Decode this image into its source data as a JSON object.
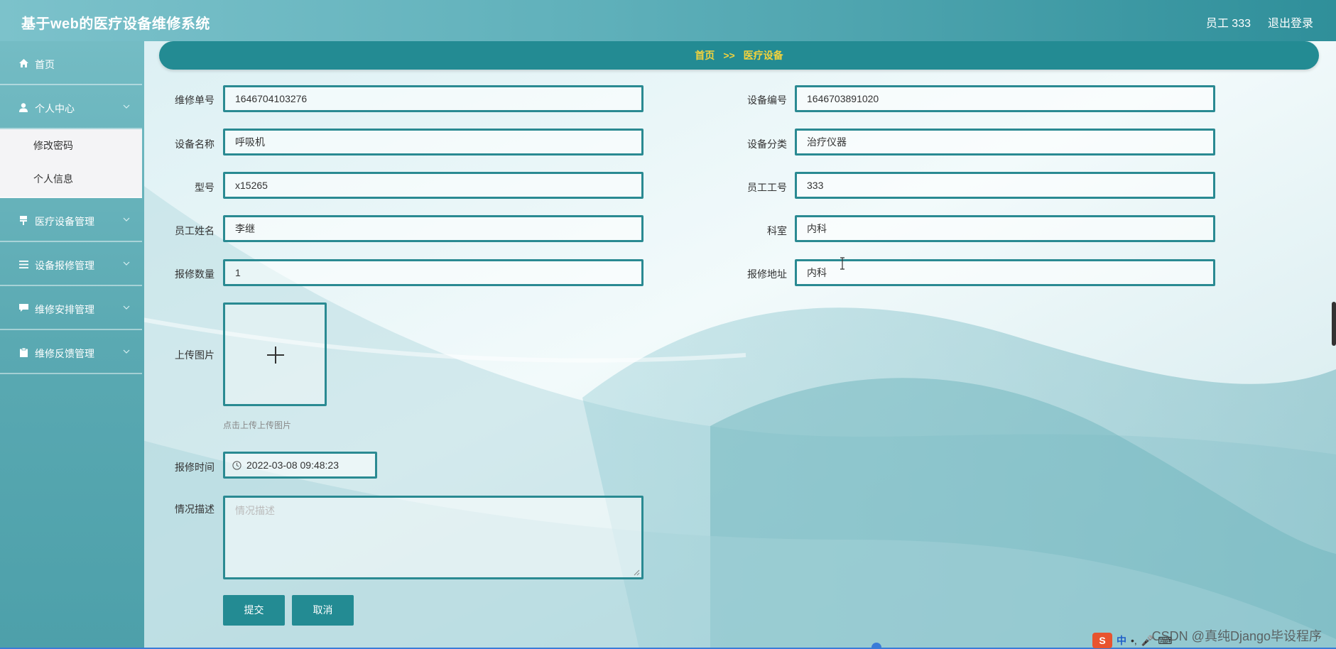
{
  "header": {
    "title": "基于web的医疗设备维修系统",
    "user": "员工 333",
    "logout": "退出登录"
  },
  "sidebar": {
    "items": [
      {
        "label": "首页",
        "icon": "home-icon"
      },
      {
        "label": "个人中心",
        "icon": "user-icon",
        "expanded": true,
        "children": [
          {
            "label": "修改密码"
          },
          {
            "label": "个人信息"
          }
        ]
      },
      {
        "label": "医疗设备管理",
        "icon": "equipment-icon"
      },
      {
        "label": "设备报修管理",
        "icon": "list-icon"
      },
      {
        "label": "维修安排管理",
        "icon": "comment-icon"
      },
      {
        "label": "维修反馈管理",
        "icon": "clipboard-icon"
      }
    ]
  },
  "breadcrumb": {
    "home": "首页",
    "separator": ">>",
    "current": "医疗设备"
  },
  "form": {
    "repair_no": {
      "label": "维修单号",
      "value": "1646704103276"
    },
    "device_no": {
      "label": "设备编号",
      "value": "1646703891020"
    },
    "device_name": {
      "label": "设备名称",
      "value": "呼吸机"
    },
    "device_category": {
      "label": "设备分类",
      "value": "治疗仪器"
    },
    "model": {
      "label": "型号",
      "value": "x15265"
    },
    "employee_no": {
      "label": "员工工号",
      "value": "333"
    },
    "employee_name": {
      "label": "员工姓名",
      "value": "李继"
    },
    "department": {
      "label": "科室",
      "value": "内科"
    },
    "repair_qty": {
      "label": "报修数量",
      "value": "1"
    },
    "repair_address": {
      "label": "报修地址",
      "value": "内科"
    },
    "upload": {
      "label": "上传图片",
      "hint": "点击上传上传图片"
    },
    "repair_time": {
      "label": "报修时间",
      "value": "2022-03-08 09:48:23"
    },
    "description": {
      "label": "情况描述",
      "placeholder": "情况描述"
    },
    "submit": "提交",
    "cancel": "取消"
  },
  "overlay": {
    "ime_lang": "中",
    "watermark": "CSDN @真纯Django毕设程序"
  },
  "colors": {
    "primary": "#238b93",
    "border": "#2a8a92",
    "breadcrumb_text": "#f3d33c"
  }
}
